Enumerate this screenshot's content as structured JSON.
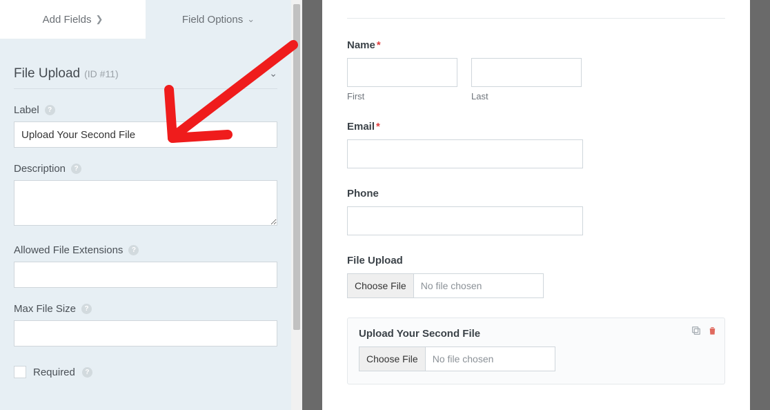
{
  "tabs": {
    "add_fields": "Add Fields",
    "field_options": "Field Options"
  },
  "field_options": {
    "heading": "File Upload",
    "id_text": "(ID #11)",
    "label_label": "Label",
    "label_value": "Upload Your Second File",
    "description_label": "Description",
    "description_value": "",
    "allowed_ext_label": "Allowed File Extensions",
    "allowed_ext_value": "",
    "max_size_label": "Max File Size",
    "max_size_value": "",
    "required_label": "Required"
  },
  "preview": {
    "name": {
      "label": "Name",
      "required": true,
      "first_sub": "First",
      "last_sub": "Last"
    },
    "email": {
      "label": "Email",
      "required": true
    },
    "phone": {
      "label": "Phone",
      "required": false
    },
    "file1": {
      "label": "File Upload",
      "button": "Choose File",
      "status": "No file chosen"
    },
    "file2": {
      "label": "Upload Your Second File",
      "button": "Choose File",
      "status": "No file chosen"
    }
  }
}
